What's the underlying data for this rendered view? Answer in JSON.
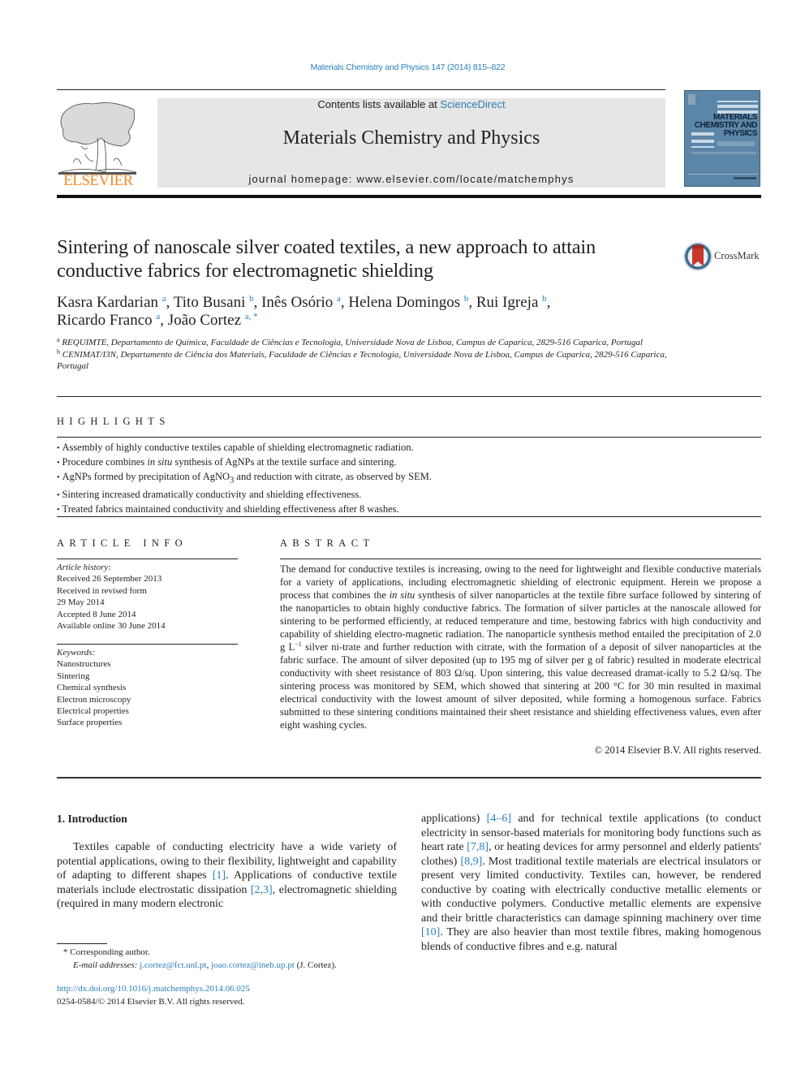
{
  "header": {
    "citation": "Materials Chemistry and Physics 147 (2014) 815–822",
    "contents_prefix": "Contents lists available at ",
    "contents_link": "ScienceDirect",
    "journal_title": "Materials Chemistry and Physics",
    "homepage_prefix": "journal homepage: ",
    "homepage_url": "www.elsevier.com/locate/matchemphys",
    "publisher_logo_text": "ELSEVIER",
    "publisher_logo_icon": "elsevier-tree-icon",
    "cover_title_lines": [
      "MATERIALS",
      "CHEMISTRY AND",
      "PHYSICS"
    ],
    "brand_color": "#f28c28",
    "link_color": "#2a7fb8"
  },
  "article": {
    "title": "Sintering of nanoscale silver coated textiles, a new approach to attain conductive fabrics for electromagnetic shielding",
    "crossmark_label": "CrossMark",
    "authors": [
      {
        "name": "Kasra Kardarian",
        "aff": "a",
        "sep": ", "
      },
      {
        "name": "Tito Busani",
        "aff": "b",
        "sep": ", "
      },
      {
        "name": "Inês Osório",
        "aff": "a",
        "sep": ", "
      },
      {
        "name": "Helena Domingos",
        "aff": "b",
        "sep": ", "
      },
      {
        "name": "Rui Igreja",
        "aff": "b",
        "sep": ","
      },
      {
        "name": "Ricardo Franco",
        "aff": "a",
        "sep": ", "
      },
      {
        "name": "João Cortez",
        "aff": "a, *",
        "sep": ""
      }
    ],
    "affiliations": [
      {
        "key": "a",
        "text": "REQUIMTE, Departamento de Química, Faculdade de Ciências e Tecnologia, Universidade Nova de Lisboa, Campus de Caparica, 2829-516 Caparica, Portugal"
      },
      {
        "key": "b",
        "text": "CENIMAT/I3N, Departamento de Ciência dos Materiais, Faculdade de Ciências e Tecnologia, Universidade Nova de Lisboa, Campus de Caparica, 2829-516 Caparica, Portugal"
      }
    ]
  },
  "highlights": {
    "heading": "HIGHLIGHTS",
    "items": [
      "Assembly of highly conductive textiles capable of shielding electromagnetic radiation.",
      "Procedure combines <i>in situ</i> synthesis of AgNPs at the textile surface and sintering.",
      "AgNPs formed by precipitation of AgNO<sub>3</sub> and reduction with citrate, as observed by SEM.",
      "Sintering increased dramatically conductivity and shielding effectiveness.",
      "Treated fabrics maintained conductivity and shielding effectiveness after 8 washes."
    ]
  },
  "article_info": {
    "heading": "ARTICLE INFO",
    "history_label": "Article history:",
    "history": [
      "Received 26 September 2013",
      "Received in revised form",
      "29 May 2014",
      "Accepted 8 June 2014",
      "Available online 30 June 2014"
    ],
    "keywords_label": "Keywords:",
    "keywords": [
      "Nanostructures",
      "Sintering",
      "Chemical synthesis",
      "Electron microscopy",
      "Electrical properties",
      "Surface properties"
    ]
  },
  "abstract": {
    "heading": "ABSTRACT",
    "html": "The demand for conductive textiles is increasing, owing to the need for lightweight and flexible conductive materials for a variety of applications, including electromagnetic shielding of electronic equipment. Herein we propose a process that combines the <i>in situ</i> synthesis of silver nanoparticles at the textile fibre surface followed by sintering of the nanoparticles to obtain highly conductive fabrics. The formation of silver particles at the nanoscale allowed for sintering to be performed efficiently, at reduced temperature and time, bestowing fabrics with high conductivity and capability of shielding electro-magnetic radiation. The nanoparticle synthesis method entailed the precipitation of 2.0 g L<sup>−1</sup> silver ni-trate and further reduction with citrate, with the formation of a deposit of silver nanoparticles at the fabric surface. The amount of silver deposited (up to 195 mg of silver per g of fabric) resulted in moderate electrical conductivity with sheet resistance of 803 Ω/sq. Upon sintering, this value decreased dramat-ically to 5.2 Ω/sq. The sintering process was monitored by SEM, which showed that sintering at 200 °C for 30 min resulted in maximal electrical conductivity with the lowest amount of silver deposited, while forming a homogenous surface. Fabrics submitted to these sintering conditions maintained their sheet resistance and shielding effectiveness values, even after eight washing cycles.",
    "copyright": "© 2014 Elsevier B.V. All rights reserved."
  },
  "introduction": {
    "heading": "1.  Introduction",
    "col1_html": "Textiles capable of conducting electricity have a wide variety of potential applications, owing to their flexibility, lightweight and capability of adapting to different shapes <a class=\"link\">[1]</a>. Applications of conductive textile materials include electrostatic dissipation <a class=\"link\">[2,3]</a>, electromagnetic shielding (required in many modern electronic",
    "col2_html": "applications) <a class=\"link\">[4–6]</a> and for technical textile applications (to conduct electricity in sensor-based materials for monitoring body functions such as heart rate <a class=\"link\">[7,8]</a>, or heating devices for army personnel and elderly patients' clothes) <a class=\"link\">[8,9]</a>. Most traditional textile materials are electrical insulators or present very limited conductivity. Textiles can, however, be rendered conductive by coating with electrically conductive metallic elements or with conductive polymers. Conductive metallic elements are expensive and their brittle characteristics can damage spinning machinery over time <a class=\"link\">[10]</a>. They are also heavier than most textile fibres, making homogenous blends of conductive fibres and e.g. natural"
  },
  "footnote": {
    "corresponding": "* Corresponding author.",
    "email_label": "E-mail addresses:",
    "emails": [
      "j.cortez@fct.unl.pt",
      "joao.cortez@ineb.up.pt"
    ],
    "email_suffix": "(J. Cortez).",
    "doi": "http://dx.doi.org/10.1016/j.matchemphys.2014.06.025",
    "issn_copyright": "0254-0584/© 2014 Elsevier B.V. All rights reserved."
  }
}
